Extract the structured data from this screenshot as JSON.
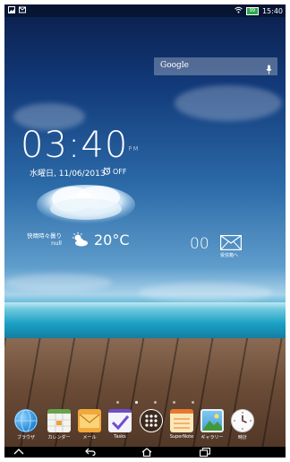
{
  "status_bar": {
    "left_icons": [
      "gallery-icon",
      "notification-icon"
    ],
    "right_icons": [
      "wifi-icon",
      "battery-icon"
    ],
    "battery_text": "99",
    "time": "15:40"
  },
  "search_widget": {
    "label": "Google",
    "icon": "mic-icon"
  },
  "clock_widget": {
    "time": "03:40",
    "ampm": "PM",
    "date": "水曜日, 11/06/2013",
    "alarm": "OFF"
  },
  "weather_widget": {
    "condition_line1": "快晴時々曇り",
    "condition_line2": "null",
    "temperature": "20°C"
  },
  "mail_widget": {
    "count": "00",
    "label": "受信箱へ"
  },
  "page_indicator": {
    "total": 5,
    "active": 2
  },
  "dock": [
    {
      "name": "browser",
      "label": "ブラウザ",
      "icon": "globe-icon"
    },
    {
      "name": "calendar",
      "label": "カレンダー",
      "icon": "calendar-icon"
    },
    {
      "name": "mail",
      "label": "メール",
      "icon": "envelope-icon"
    },
    {
      "name": "tasks",
      "label": "Tasks",
      "icon": "checkmark-icon"
    },
    {
      "name": "all-apps",
      "label": "",
      "icon": "app-drawer-icon"
    },
    {
      "name": "supernote",
      "label": "SuperNote",
      "icon": "notebook-icon"
    },
    {
      "name": "gallery",
      "label": "ギャラリー",
      "icon": "picture-icon"
    },
    {
      "name": "clock",
      "label": "時計",
      "icon": "clock-icon"
    }
  ],
  "nav_bar": {
    "buttons": [
      "up-chevron-icon",
      "back-icon",
      "home-icon",
      "recent-apps-icon"
    ]
  },
  "colors": {
    "battery_green": "#2aa84a",
    "status_bar_bg": "#00000059",
    "nav_bar_bg": "#000000"
  }
}
